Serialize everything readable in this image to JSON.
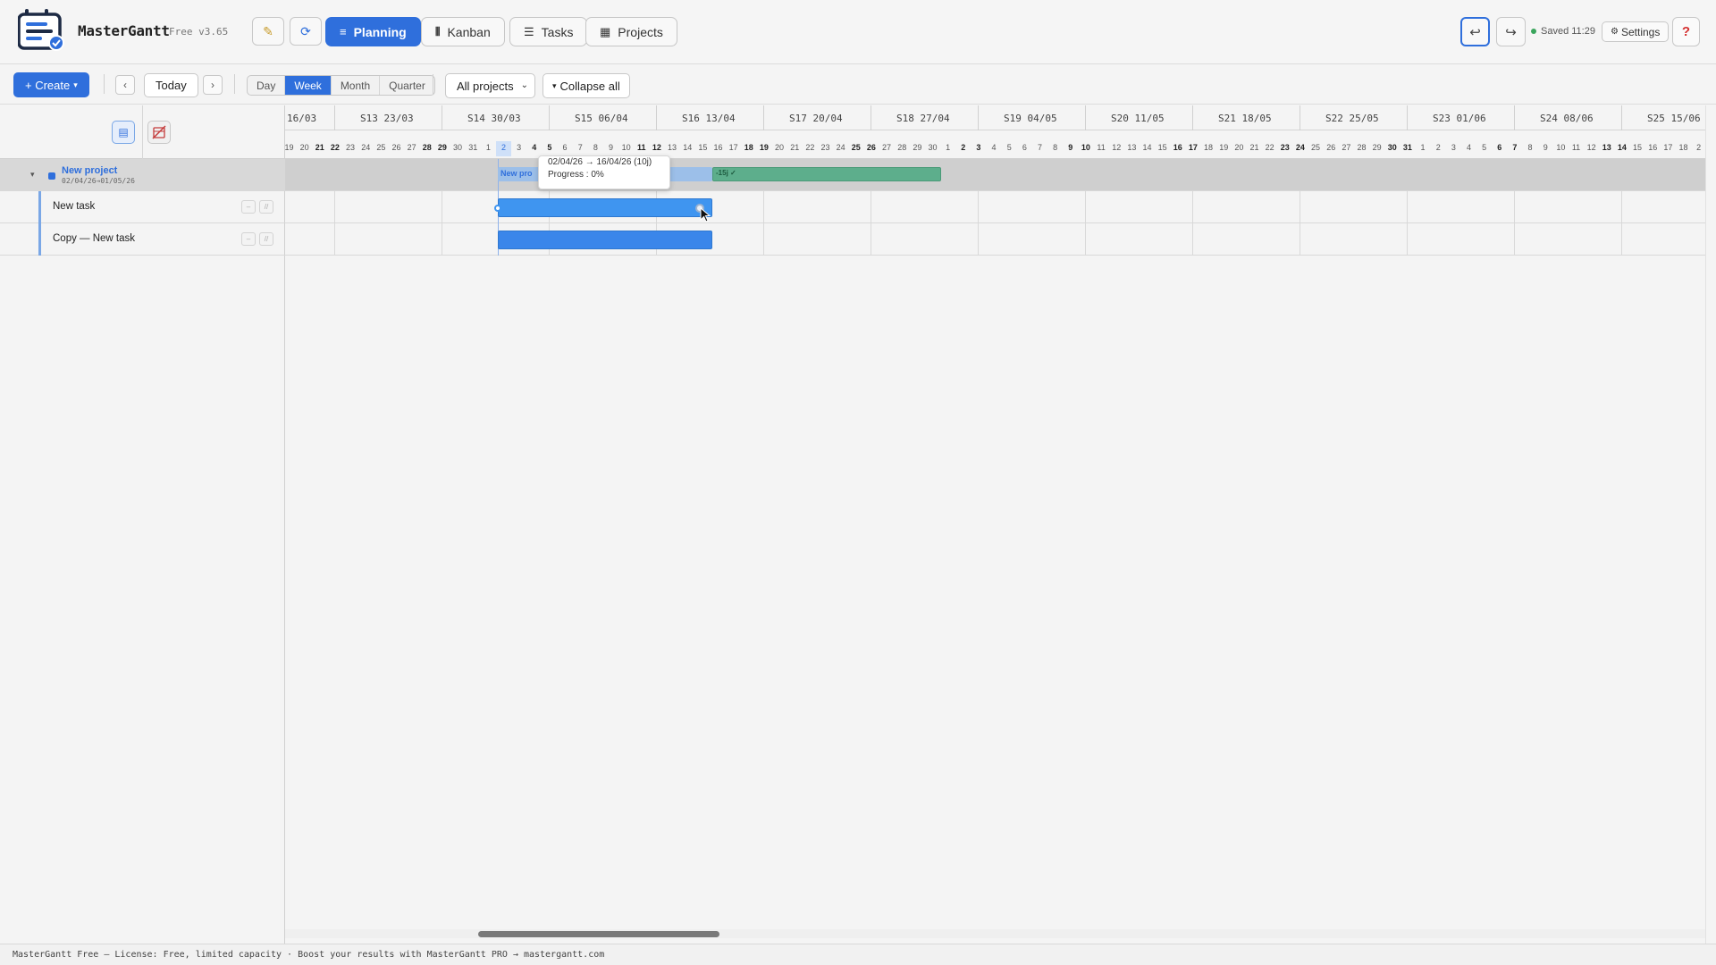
{
  "header": {
    "app_name": "MasterGantt",
    "version": "Free v3.65",
    "nav": [
      {
        "label": "Planning",
        "active": true
      },
      {
        "label": "Kanban",
        "active": false
      },
      {
        "label": "Tasks",
        "active": false
      },
      {
        "label": "Projects",
        "active": false
      }
    ],
    "saved_text": "Saved 11:29",
    "settings_label": "Settings",
    "help_label": "?"
  },
  "toolbar": {
    "create_label": "+ Create",
    "prev": "‹",
    "today_label": "Today",
    "next": "›",
    "views": [
      "Day",
      "Week",
      "Month",
      "Quarter"
    ],
    "active_view": "Week",
    "project_filter": "All projects",
    "collapse_label": "Collapse all"
  },
  "tree": {
    "project": {
      "name": "New project",
      "dates": "02/04/26→01/05/26"
    },
    "tasks": [
      {
        "name": "New task"
      },
      {
        "name": "Copy — New task"
      }
    ],
    "row_action_a": "–",
    "row_action_b": "//"
  },
  "timeline": {
    "weeks": [
      "16/03",
      "S13 23/03",
      "S14 30/03",
      "S15 06/04",
      "S16 13/04",
      "S17 20/04",
      "S18 27/04",
      "S19 04/05",
      "S20 11/05",
      "S21 18/05",
      "S22 25/05",
      "S23 01/06",
      "S24 08/06",
      "S25 15/06"
    ],
    "days": [
      "19",
      "20",
      "21",
      "22",
      "23",
      "24",
      "25",
      "26",
      "27",
      "28",
      "29",
      "30",
      "31",
      "1",
      "2",
      "3",
      "4",
      "5",
      "6",
      "7",
      "8",
      "9",
      "10",
      "11",
      "12",
      "13",
      "14",
      "15",
      "16",
      "17",
      "18",
      "19",
      "20",
      "21",
      "22",
      "23",
      "24",
      "25",
      "26",
      "27",
      "28",
      "29",
      "30",
      "1",
      "2",
      "3",
      "4",
      "5",
      "6",
      "7",
      "8",
      "9",
      "10",
      "11",
      "12",
      "13",
      "14",
      "15",
      "16",
      "17",
      "18",
      "19",
      "20",
      "21",
      "22",
      "23",
      "24",
      "25",
      "26",
      "27",
      "28",
      "29",
      "30",
      "31",
      "1",
      "2",
      "3",
      "4",
      "5",
      "6",
      "7",
      "8",
      "9",
      "10",
      "11",
      "12",
      "13",
      "14",
      "15",
      "16",
      "17",
      "18",
      "2"
    ],
    "project_bar_label": "New pro",
    "project_slack_label": "-15j ✓",
    "tooltip_line1": "02/04/26 → 16/04/26 (10j)",
    "tooltip_line2": "Progress : 0%"
  },
  "footer": {
    "text": "MasterGantt Free — License: Free, limited capacity · Boost your results with MasterGantt PRO → mastergantt.com"
  },
  "colors": {
    "accent": "#2f6fdc",
    "task_bar": "#3f95f0",
    "slack_bar": "#5dae8c",
    "help": "#d43030"
  }
}
